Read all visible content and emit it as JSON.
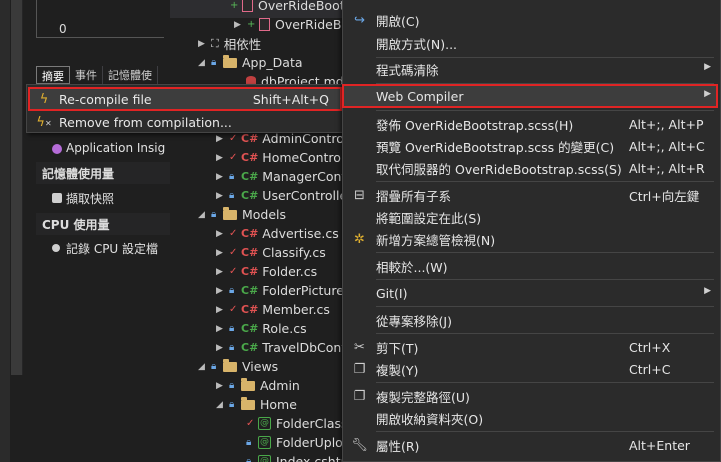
{
  "diagnostics": {
    "graph_zero": "0",
    "tabs": [
      "摘要",
      "事件",
      "記憶體使"
    ],
    "application_insights": "Application Insig",
    "memory_section": "記憶體使用量",
    "snapshot": "擷取快照",
    "cpu_section": "CPU 使用量",
    "record_cpu": "記錄 CPU 設定檔"
  },
  "tree": {
    "items": [
      {
        "label": "OverRideBootstrap.scss",
        "indent": 0
      },
      {
        "label": "OverRideBo",
        "indent": 1
      },
      {
        "label": "相依性",
        "indent": 2
      },
      {
        "label": "App_Data",
        "indent": 2
      },
      {
        "label": "dbProject.mdf",
        "indent": 3
      },
      {
        "label": "AdminControlle",
        "indent": 3
      },
      {
        "label": "HomeControlle",
        "indent": 3
      },
      {
        "label": "ManagerContr",
        "indent": 3
      },
      {
        "label": "UserController",
        "indent": 3
      },
      {
        "label": "Models",
        "indent": 2
      },
      {
        "label": "Advertise.cs",
        "indent": 3
      },
      {
        "label": "Classify.cs",
        "indent": 3
      },
      {
        "label": "Folder.cs",
        "indent": 3
      },
      {
        "label": "FolderPicture.c",
        "indent": 3
      },
      {
        "label": "Member.cs",
        "indent": 3
      },
      {
        "label": "Role.cs",
        "indent": 3
      },
      {
        "label": "TravelDbConte",
        "indent": 3
      },
      {
        "label": "Views",
        "indent": 2
      },
      {
        "label": "Admin",
        "indent": 3
      },
      {
        "label": "Home",
        "indent": 3
      },
      {
        "label": "FolderClass",
        "indent": 4
      },
      {
        "label": "FolderUplo",
        "indent": 4
      },
      {
        "label": "Index.cshtml",
        "indent": 4
      }
    ],
    "cs_glyph": "C#",
    "razor_glyph": "@"
  },
  "submenu": {
    "items": [
      {
        "label": "Re-compile file",
        "shortcut": "Shift+Alt+Q",
        "icon": "lightning-icon"
      },
      {
        "label": "Remove from compilation...",
        "shortcut": "",
        "icon": "lightning-x-icon"
      }
    ]
  },
  "context_menu": {
    "items": [
      {
        "label": "開啟(C)",
        "shortcut": "",
        "icon": "open-icon"
      },
      {
        "label": "開啟方式(N)...",
        "shortcut": "",
        "icon": ""
      },
      {
        "label": "程式碼清除",
        "shortcut": "",
        "icon": "",
        "submenu": true
      },
      {
        "label": "Web Compiler",
        "shortcut": "",
        "icon": "",
        "submenu": true,
        "highlight": true
      },
      {
        "label": "發佈 OverRideBootstrap.scss(H)",
        "shortcut": "Alt+;, Alt+P",
        "icon": ""
      },
      {
        "label": "預覽 OverRideBootstrap.scss 的變更(C)",
        "shortcut": "Alt+;, Alt+C",
        "icon": ""
      },
      {
        "label": "取代伺服器的 OverRideBootstrap.scss(S)",
        "shortcut": "Alt+;, Alt+R",
        "icon": ""
      },
      {
        "label": "摺疊所有子系",
        "shortcut": "Ctrl+向左鍵",
        "icon": "collapse-icon"
      },
      {
        "label": "將範圍設定在此(S)",
        "shortcut": "",
        "icon": ""
      },
      {
        "label": "新增方案總管檢視(N)",
        "shortcut": "",
        "icon": "new-view-icon"
      },
      {
        "label": "相較於...(W)",
        "shortcut": "",
        "icon": ""
      },
      {
        "label": "Git(I)",
        "shortcut": "",
        "icon": "",
        "submenu": true
      },
      {
        "label": "從專案移除(J)",
        "shortcut": "",
        "icon": ""
      },
      {
        "label": "剪下(T)",
        "shortcut": "Ctrl+X",
        "icon": "scissors-icon"
      },
      {
        "label": "複製(Y)",
        "shortcut": "Ctrl+C",
        "icon": "copy-icon"
      },
      {
        "label": "複製完整路徑(U)",
        "shortcut": "",
        "icon": "copy-path-icon"
      },
      {
        "label": "開啟收納資料夾(O)",
        "shortcut": "",
        "icon": ""
      },
      {
        "label": "屬性(R)",
        "shortcut": "Alt+Enter",
        "icon": "wrench-icon"
      }
    ]
  },
  "colors": {
    "highlight_outline": "#e02424",
    "menu_bg": "#2b2b2b",
    "folder": "#d8b46a",
    "csharp": "#4aa84a",
    "lock": "#6ba7e6"
  }
}
